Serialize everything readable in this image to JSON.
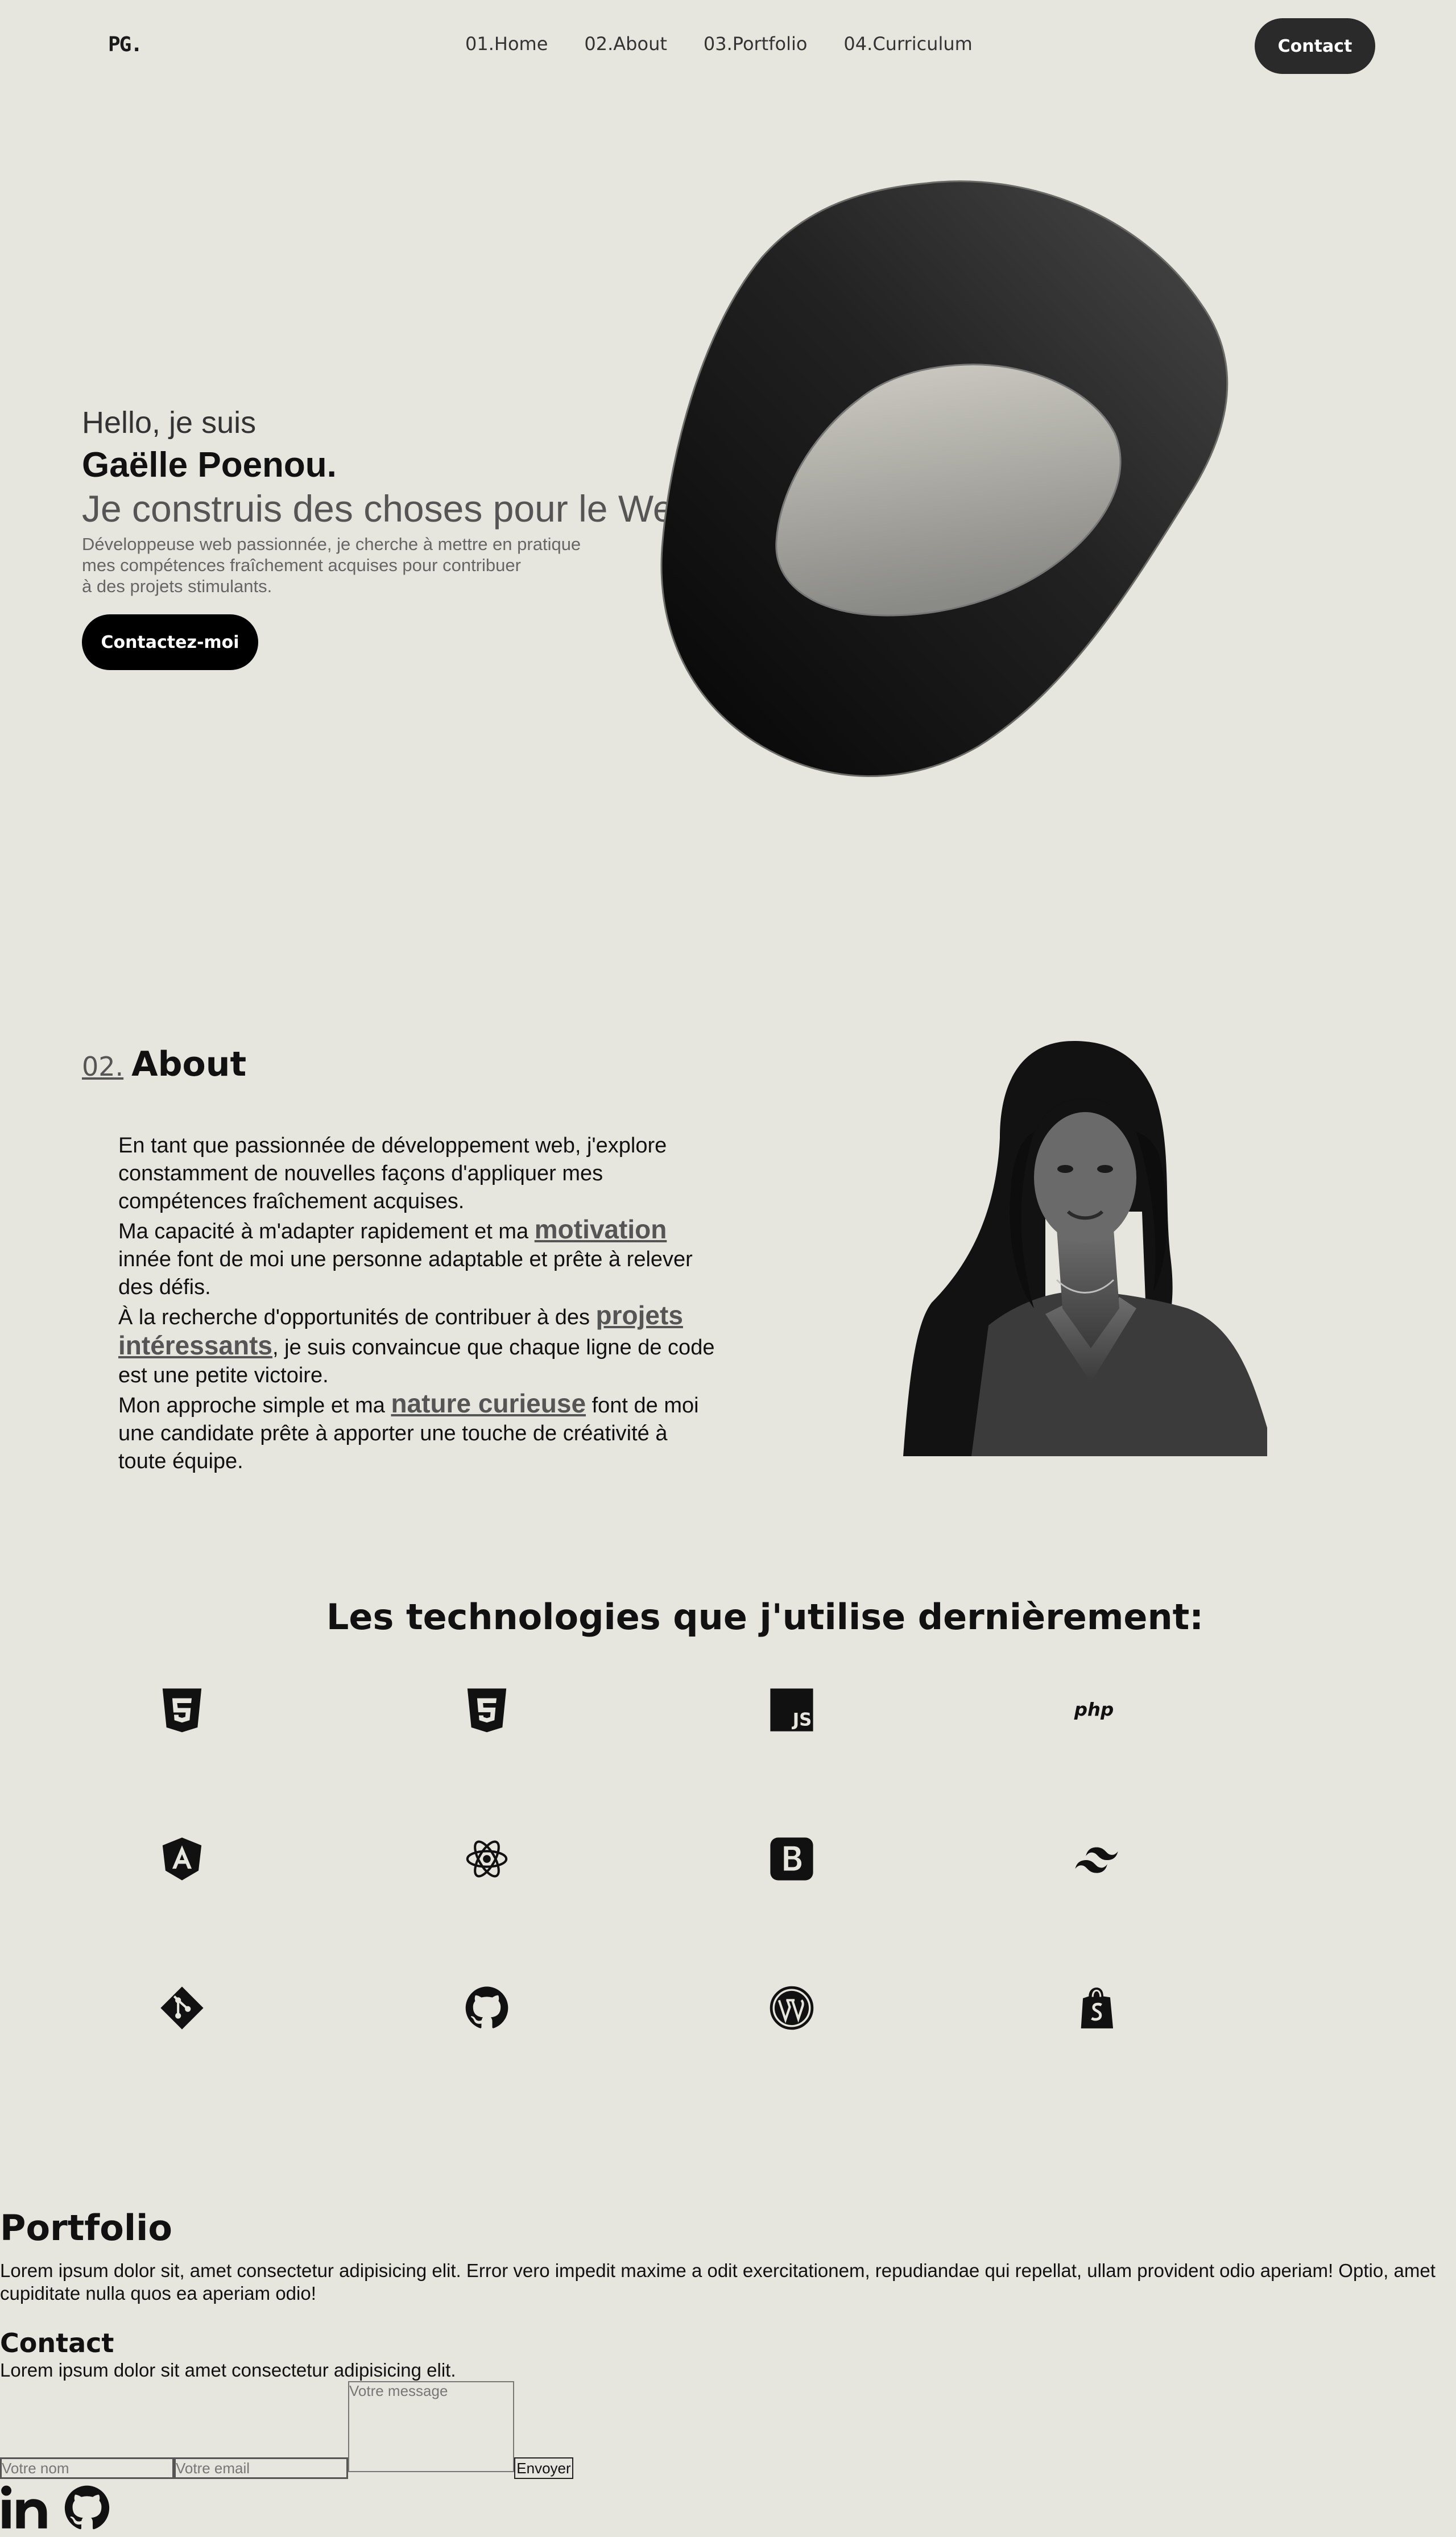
{
  "nav": {
    "logo": "PG.",
    "links": [
      "01.Home",
      "02.About",
      "03.Portfolio",
      "04.Curriculum"
    ],
    "contact": "Contact"
  },
  "hero": {
    "hello": "Hello, je suis",
    "name": "Gaëlle Poenou.",
    "tagline": "Je construis des choses pour le Web",
    "desc_lines": [
      "Développeuse web passionnée, je cherche à mettre en pratique",
      "mes compétences fraîchement acquises pour contribuer",
      "à des projets stimulants."
    ],
    "cta": "Contactez-moi"
  },
  "about": {
    "num": "02.",
    "title": "About",
    "p1": "En tant que passionnée de développement web, j'explore constamment de nouvelles façons d'appliquer mes compétences fraîchement acquises.",
    "p2_before": "Ma capacité à m'adapter rapidement et ma ",
    "p2_hl": "motivation",
    "p2_after": " innée font de moi une personne adaptable et prête à relever des défis.",
    "p3_before": "À la recherche d'opportunités de contribuer à des ",
    "p3_hl": "projets intéressants",
    "p3_after": ", je suis convaincue que chaque ligne de code est une petite victoire.",
    "p4_before": "Mon approche simple et ma ",
    "p4_hl": "nature curieuse",
    "p4_after": " font de moi une candidate prête à apporter une touche de créativité à toute équipe."
  },
  "tech": {
    "title": "Les technologies que j'utilise dernièrement:",
    "icons": [
      "html5-icon",
      "css3-icon",
      "javascript-icon",
      "php-icon",
      "angular-icon",
      "react-icon",
      "bootstrap-icon",
      "tailwind-icon",
      "git-icon",
      "github-icon",
      "wordpress-icon",
      "shopify-icon"
    ]
  },
  "portfolio": {
    "title": "Portfolio",
    "text": "Lorem ipsum dolor sit, amet consectetur adipisicing elit. Error vero impedit maxime a odit exercitationem, repudiandae qui repellat, ullam provident odio aperiam! Optio, amet cupiditate nulla quos ea aperiam odio!"
  },
  "contact": {
    "title": "Contact",
    "text": "Lorem ipsum dolor sit amet consectetur adipisicing elit.",
    "name_placeholder": "Votre nom",
    "email_placeholder": "Votre email",
    "message_placeholder": "Votre message",
    "send": "Envoyer"
  },
  "colors": {
    "background": "#e6e5de",
    "accent": "#2a2a2a",
    "muted": "#555555"
  }
}
